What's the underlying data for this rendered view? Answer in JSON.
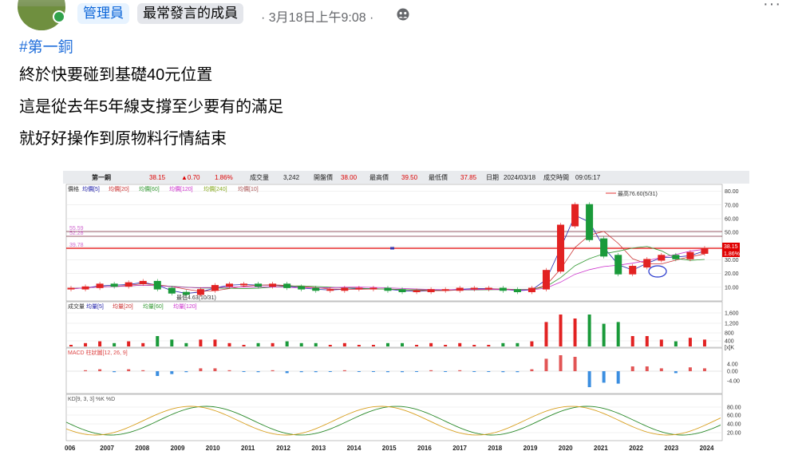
{
  "post": {
    "badge_admin": "管理員",
    "badge_member": "最常發言的成員",
    "timestamp": "· 3月18日上午9:08 ·",
    "more": "···",
    "hashtag": "#第一銅",
    "lines": [
      "終於快要碰到基礎40元位置",
      "這是從去年5年線支撐至少要有的滿足",
      "就好好操作到原物料行情結束"
    ]
  },
  "quote": {
    "name": "第一銅",
    "price": "38.15",
    "change": "▲0.70",
    "pct": "1.86%",
    "vol_label": "成交量",
    "vol": "3,242",
    "open_label": "開盤價",
    "open": "38.00",
    "high_label": "最高價",
    "high": "39.50",
    "low_label": "最低價",
    "low": "37.85",
    "date_label": "日期",
    "date": "2024/03/18",
    "time_label": "成交時間",
    "time": "09:05:17"
  },
  "legend": {
    "price": [
      "價格",
      "均價[5]",
      "均價[20]",
      "均價[60]",
      "均價[120]",
      "均價[240]",
      "均價[10]"
    ],
    "volume": [
      "成交量",
      "均量[5]",
      "均量[20]",
      "均量[60]",
      "均量[120]"
    ],
    "macd": "MACD 柱狀圖[12, 26, 9]",
    "kd": "KD[9, 3, 3] %K %D"
  },
  "annotations": {
    "high": "最高76.60(5/31)",
    "low": "最低4.63(10/31)",
    "line_39": "39.78",
    "line_55": "55.59",
    "line_52": "52.28",
    "last_price": "38.15",
    "last_pct": "1.86%"
  },
  "chart_data": {
    "type": "candlestick",
    "price_axis": [
      "80.00",
      "70.00",
      "60.00",
      "50.00",
      "40.00",
      "30.00",
      "20.00",
      "10.00"
    ],
    "volume_axis": [
      "1,600",
      "1,200",
      "800",
      "400",
      "[x]K"
    ],
    "macd_axis": [
      "4.00",
      "0.00",
      "-4.00"
    ],
    "kd_axis": [
      "80.00",
      "60.00",
      "40.00",
      "20.00"
    ],
    "years": [
      "006",
      "2007",
      "2008",
      "2009",
      "2010",
      "2011",
      "2012",
      "2013",
      "2014",
      "2015",
      "2016",
      "2017",
      "2018",
      "2019",
      "2020",
      "2021",
      "2022",
      "2023",
      "2024"
    ],
    "price": [
      9,
      10,
      12,
      11,
      13,
      14,
      9,
      6,
      5,
      8,
      11,
      12,
      12,
      11,
      12,
      10,
      9,
      8,
      8,
      9,
      9,
      9,
      8,
      7,
      7,
      8,
      8,
      9,
      9,
      9,
      8,
      7,
      9,
      22,
      55,
      70,
      45,
      33,
      20,
      25,
      30,
      33,
      31,
      35,
      38
    ]
  },
  "colors": {
    "up": "#e22222",
    "down": "#1a9a3a",
    "accent": "#216fdb"
  }
}
